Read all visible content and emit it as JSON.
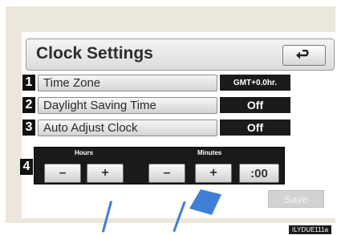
{
  "header": {
    "title": "Clock Settings",
    "back_icon": "back-arrow-icon"
  },
  "rows": [
    {
      "number": "1",
      "label": "Time Zone",
      "value": "GMT+0.0hr."
    },
    {
      "number": "2",
      "label": "Daylight Saving Time",
      "value": "Off"
    },
    {
      "number": "3",
      "label": "Auto Adjust Clock",
      "value": "Off"
    }
  ],
  "clock_adjust": {
    "number": "4",
    "hours_label": "Hours",
    "minutes_label": "Minutes",
    "minus": "–",
    "plus": "+",
    "reset": ":00"
  },
  "footer": {
    "save_label": "Save",
    "image_code": "ILYDUE111a"
  },
  "colors": {
    "frame": "#ebe7da",
    "value_bg": "#1b1b1b",
    "accent_deco": "#3f7fd6"
  }
}
